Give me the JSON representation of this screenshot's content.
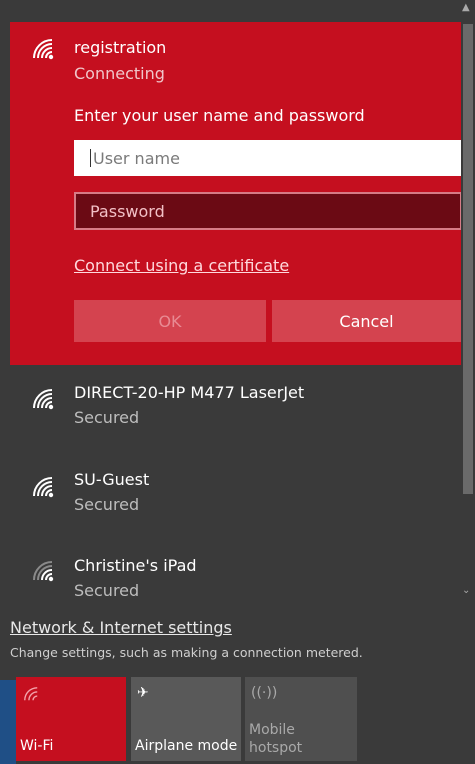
{
  "active_network": {
    "name": "registration",
    "status": "Connecting",
    "prompt": "Enter your user name and password",
    "username_placeholder": "User name",
    "password_placeholder": "Password",
    "cert_link": "Connect using a certificate",
    "ok_label": "OK",
    "cancel_label": "Cancel"
  },
  "networks": [
    {
      "name": "DIRECT-20-HP M477 LaserJet",
      "status": "Secured"
    },
    {
      "name": "SU-Guest",
      "status": "Secured"
    },
    {
      "name": "Christine's iPad",
      "status": "Secured"
    }
  ],
  "settings": {
    "link": "Network & Internet settings",
    "description": "Change settings, such as making a connection metered."
  },
  "quick_actions": [
    {
      "label": "Wi-Fi",
      "icon": "wifi-icon"
    },
    {
      "label": "Airplane mode",
      "icon": "airplane-icon"
    },
    {
      "label_line1": "Mobile",
      "label_line2": "hotspot",
      "icon": "hotspot-icon"
    }
  ],
  "colors": {
    "accent": "#c50f1f",
    "background": "#3a3a3a"
  }
}
